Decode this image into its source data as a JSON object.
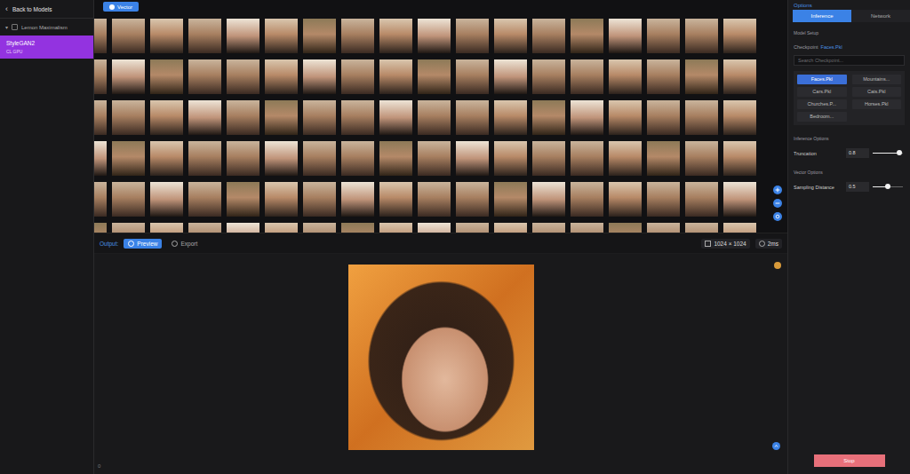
{
  "sidebar": {
    "back": {
      "icon": "‹",
      "label": "Back to Models"
    },
    "workspace": {
      "icon": "▾",
      "label": "Lemon Maximalism"
    },
    "models": [
      {
        "name": "StyleGAN2",
        "sub": "CL GPU",
        "selected": true
      }
    ]
  },
  "toolbar": {
    "mode": "Vector"
  },
  "output": {
    "label": "Output:",
    "tabs": [
      {
        "label": "Preview",
        "selected": true
      },
      {
        "label": "Export",
        "selected": false
      }
    ],
    "resolution": "1024 × 1024",
    "time": "2ms"
  },
  "footer": {
    "count": "0"
  },
  "options": {
    "title": "Options",
    "tabs": [
      {
        "label": "Inference",
        "selected": true
      },
      {
        "label": "Network",
        "selected": false
      }
    ],
    "model_setup": {
      "heading": "Model Setup",
      "checkpoint_label": "Checkpoint",
      "checkpoint_value": "Faces.Pkl",
      "search_placeholder": "Search Checkpoint...",
      "checkpoints": [
        {
          "label": "Faces.Pkl",
          "selected": true
        },
        {
          "label": "Mountains...",
          "selected": false
        },
        {
          "label": "Cars.Pkl",
          "selected": false
        },
        {
          "label": "Cats.Pkl",
          "selected": false
        },
        {
          "label": "Churches.P...",
          "selected": false
        },
        {
          "label": "Horses.Pkl",
          "selected": false
        },
        {
          "label": "Bedroom...",
          "selected": false
        }
      ]
    },
    "inference": {
      "heading": "Inference Options",
      "fields": [
        {
          "label": "Truncation",
          "value": "0.8",
          "level": 0.88
        }
      ]
    },
    "vector": {
      "heading": "Vector Options",
      "fields": [
        {
          "label": "Sampling Distance",
          "value": "0.5",
          "level": 0.5
        }
      ]
    },
    "stop": "Stop"
  }
}
